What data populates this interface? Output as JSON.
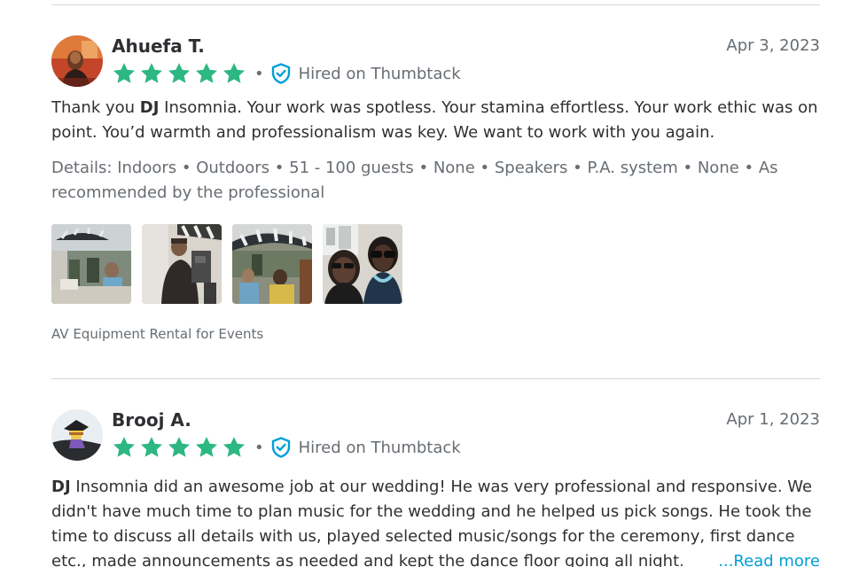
{
  "reviews": [
    {
      "name": "Ahuefa T.",
      "date": "Apr 3, 2023",
      "rating": 5,
      "hired_label": "Hired on Thumbtack",
      "text_bold": "DJ",
      "text_before": "Thank you ",
      "text_after": " Insomnia. Your work was spotless. Your stamina effortless. Your work ethic was on point. You’d warmth and professionalism was key. We want to work with you again.",
      "details": "Details: Indoors • Outdoors • 51 - 100 guests • None • Speakers • P.A. system • None • As recommended by the professional",
      "photo_count": 4,
      "category": "AV Equipment Rental for Events"
    },
    {
      "name": "Brooj A.",
      "date": "Apr 1, 2023",
      "rating": 5,
      "hired_label": "Hired on Thumbtack",
      "text_bold": "DJ",
      "text_after": " Insomnia did an awesome job at our wedding! He was very professional and responsive. We didn't have much time to plan music for the wedding and he helped us pick songs. He took the time to discuss all details with us, played selected music/songs for the ceremony, first dance etc., made announcements as needed and kept the dance floor going all night.",
      "read_more_label": "...Read more"
    }
  ],
  "colors": {
    "star_green": "#2db783",
    "shield_blue": "#009fd9",
    "link_blue": "#009fd9"
  },
  "icons": {
    "star": "star-icon",
    "verified": "shield-check-icon"
  }
}
